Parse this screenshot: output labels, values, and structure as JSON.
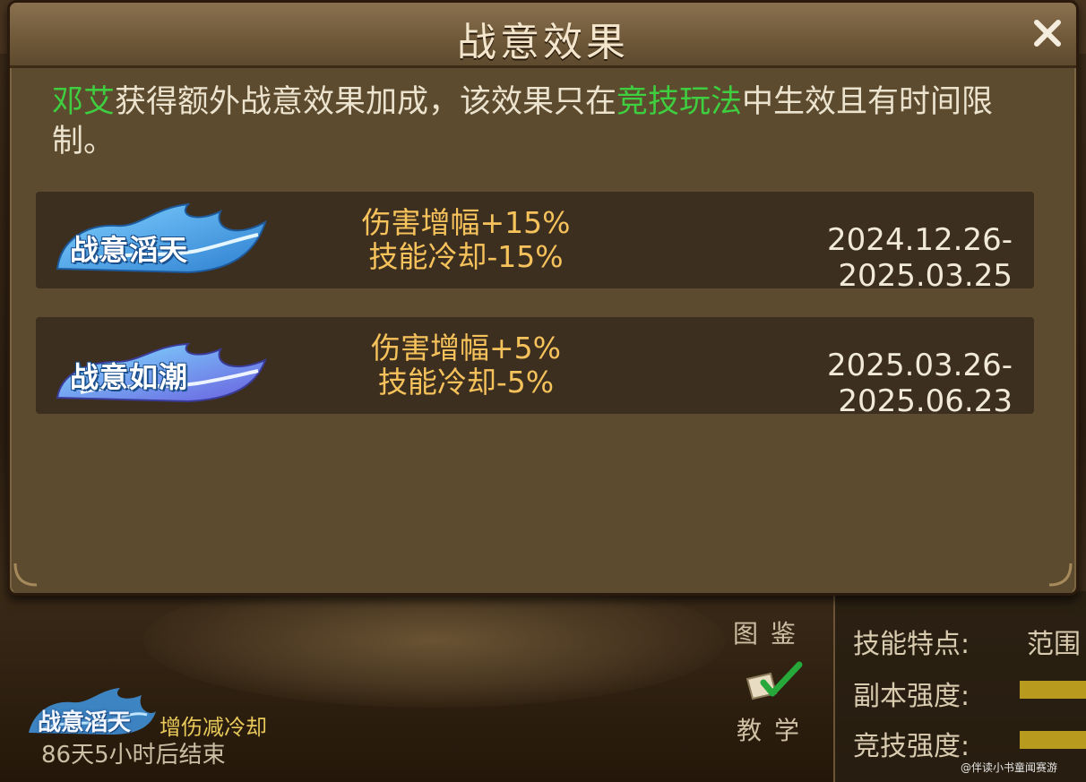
{
  "dialog": {
    "title": "战意效果",
    "close_label": "X",
    "description": {
      "hero": "邓艾",
      "part1": "获得额外战意效果加成，该效果只在",
      "mode": "竞技玩法",
      "part2": "中生效且有时间限制。"
    },
    "effects": [
      {
        "name": "战意滔天",
        "stat_damage": "伤害增幅+15%",
        "stat_cooldown": "技能冷却-15%",
        "date_range": "2024.12.26-2025.03.25",
        "badge_color": "#4fa6e8",
        "badge_icon": "wave-badge-icon"
      },
      {
        "name": "战意如潮",
        "stat_damage": "伤害增幅+5%",
        "stat_cooldown": "技能冷却-5%",
        "date_range": "2025.03.26-2025.06.23",
        "badge_color": "#6f74e0",
        "badge_icon": "wave-badge-icon"
      }
    ]
  },
  "background": {
    "buttons": {
      "gallery": "图鉴",
      "tutorial": "教学"
    },
    "stats": {
      "skill_trait_label": "技能特点:",
      "skill_trait_value": "范围",
      "dungeon_strength_label": "副本强度:",
      "arena_strength_label": "竞技强度:"
    },
    "status": {
      "badge": "战意滔天",
      "desc": "增伤减冷却",
      "timer": "86天5小时后结束"
    },
    "watermark": "@伴读小书童闻赛游"
  },
  "colors": {
    "accent_green": "#3fce3f",
    "stat_gold": "#f6c25b",
    "panel_brown": "#5c4b2e",
    "row_dark": "#3d2f1f"
  }
}
